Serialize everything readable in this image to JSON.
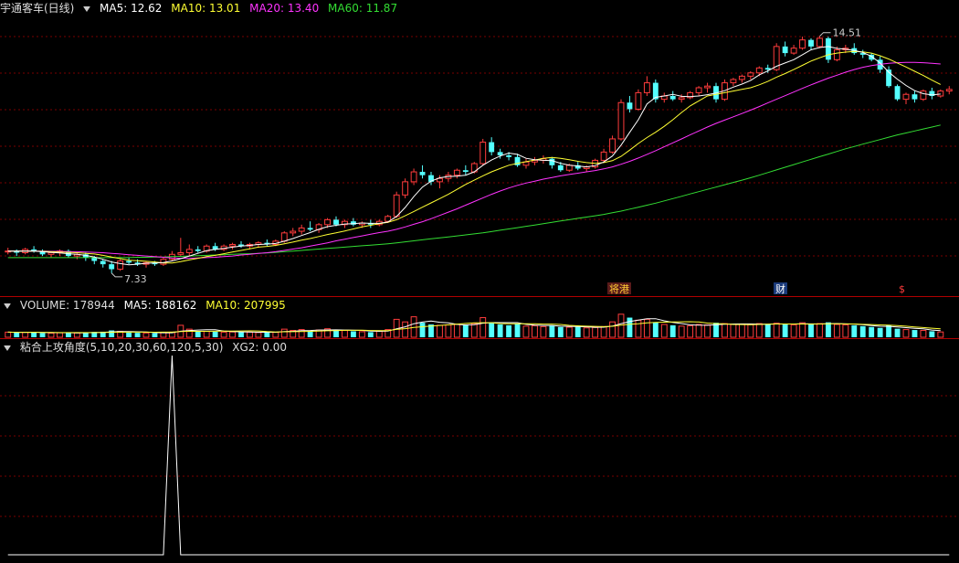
{
  "colors": {
    "up": "#ff3c3c",
    "down": "#54ffff",
    "ma5": "#ffffff",
    "ma10": "#ffff33",
    "ma20": "#ff33ff",
    "ma60": "#33dd33",
    "grid": "#7a0000",
    "signal": "#ffffff"
  },
  "price_header": {
    "stock": "宇通客车(日线)",
    "ma5": "MA5: 12.62",
    "ma10": "MA10: 13.01",
    "ma20": "MA20: 13.40",
    "ma60": "MA60: 11.87"
  },
  "volume_header": {
    "title": "VOLUME: 178944",
    "ma5": "MA5: 188162",
    "ma10": "MA10: 207995"
  },
  "indicator_header": {
    "title": "粘合上攻角度(5,10,20,30,60,120,5,30)",
    "xg2": "XG2: 0.00"
  },
  "markers": {
    "high": "14.51",
    "low": "7.33",
    "event1": "将港",
    "event2": "财",
    "event3": "$"
  },
  "chart_data": [
    {
      "type": "candlestick",
      "ylim": [
        6.8,
        15.0
      ],
      "ohlc": [
        [
          8.0,
          8.1,
          7.9,
          8.0
        ],
        [
          8.0,
          8.05,
          7.85,
          7.95
        ],
        [
          7.95,
          8.1,
          7.9,
          8.05
        ],
        [
          8.05,
          8.15,
          7.95,
          8.0
        ],
        [
          8.0,
          8.05,
          7.85,
          7.9
        ],
        [
          7.9,
          8.0,
          7.8,
          7.95
        ],
        [
          7.95,
          8.05,
          7.85,
          8.0
        ],
        [
          8.0,
          8.05,
          7.8,
          7.85
        ],
        [
          7.85,
          7.95,
          7.75,
          7.9
        ],
        [
          7.9,
          7.95,
          7.7,
          7.8
        ],
        [
          7.8,
          7.85,
          7.6,
          7.7
        ],
        [
          7.7,
          7.75,
          7.5,
          7.6
        ],
        [
          7.6,
          7.7,
          7.33,
          7.45
        ],
        [
          7.45,
          7.75,
          7.4,
          7.7
        ],
        [
          7.7,
          7.8,
          7.6,
          7.65
        ],
        [
          7.65,
          7.75,
          7.55,
          7.6
        ],
        [
          7.6,
          7.7,
          7.5,
          7.65
        ],
        [
          7.65,
          7.7,
          7.55,
          7.6
        ],
        [
          7.6,
          7.8,
          7.55,
          7.75
        ],
        [
          7.75,
          8.0,
          7.7,
          7.9
        ],
        [
          7.9,
          8.4,
          7.85,
          7.95
        ],
        [
          7.95,
          8.2,
          7.85,
          8.05
        ],
        [
          8.05,
          8.15,
          7.95,
          8.0
        ],
        [
          8.0,
          8.2,
          7.95,
          8.15
        ],
        [
          8.15,
          8.25,
          8.0,
          8.05
        ],
        [
          8.05,
          8.2,
          8.0,
          8.15
        ],
        [
          8.15,
          8.25,
          8.05,
          8.2
        ],
        [
          8.2,
          8.3,
          8.1,
          8.15
        ],
        [
          8.15,
          8.25,
          8.05,
          8.2
        ],
        [
          8.2,
          8.3,
          8.1,
          8.25
        ],
        [
          8.25,
          8.35,
          8.15,
          8.2
        ],
        [
          8.2,
          8.35,
          8.15,
          8.3
        ],
        [
          8.3,
          8.6,
          8.25,
          8.55
        ],
        [
          8.55,
          8.7,
          8.45,
          8.6
        ],
        [
          8.6,
          8.8,
          8.5,
          8.7
        ],
        [
          8.7,
          8.9,
          8.6,
          8.65
        ],
        [
          8.65,
          8.85,
          8.55,
          8.8
        ],
        [
          8.8,
          9.0,
          8.7,
          8.95
        ],
        [
          8.95,
          9.05,
          8.75,
          8.8
        ],
        [
          8.8,
          8.95,
          8.7,
          8.9
        ],
        [
          8.9,
          9.0,
          8.75,
          8.8
        ],
        [
          8.8,
          8.9,
          8.7,
          8.85
        ],
        [
          8.85,
          8.95,
          8.7,
          8.8
        ],
        [
          8.8,
          8.95,
          8.75,
          8.9
        ],
        [
          8.9,
          9.1,
          8.85,
          9.05
        ],
        [
          9.05,
          9.8,
          9.0,
          9.7
        ],
        [
          9.7,
          10.2,
          9.6,
          10.1
        ],
        [
          10.1,
          10.5,
          10.0,
          10.4
        ],
        [
          10.4,
          10.6,
          10.2,
          10.3
        ],
        [
          10.3,
          10.4,
          10.0,
          10.1
        ],
        [
          10.1,
          10.3,
          9.9,
          10.2
        ],
        [
          10.2,
          10.4,
          10.1,
          10.3
        ],
        [
          10.3,
          10.5,
          10.2,
          10.45
        ],
        [
          10.45,
          10.6,
          10.3,
          10.4
        ],
        [
          10.4,
          10.7,
          10.35,
          10.65
        ],
        [
          10.65,
          11.4,
          10.6,
          11.3
        ],
        [
          11.3,
          11.45,
          10.9,
          11.0
        ],
        [
          11.0,
          11.1,
          10.8,
          10.9
        ],
        [
          10.9,
          11.0,
          10.75,
          10.85
        ],
        [
          10.85,
          10.95,
          10.55,
          10.6
        ],
        [
          10.6,
          10.8,
          10.5,
          10.7
        ],
        [
          10.7,
          10.85,
          10.6,
          10.75
        ],
        [
          10.75,
          10.9,
          10.65,
          10.8
        ],
        [
          10.8,
          10.85,
          10.5,
          10.6
        ],
        [
          10.6,
          10.7,
          10.4,
          10.45
        ],
        [
          10.45,
          10.65,
          10.4,
          10.6
        ],
        [
          10.6,
          10.7,
          10.45,
          10.5
        ],
        [
          10.5,
          10.6,
          10.4,
          10.55
        ],
        [
          10.55,
          10.8,
          10.5,
          10.75
        ],
        [
          10.75,
          11.1,
          10.7,
          11.0
        ],
        [
          11.0,
          11.5,
          10.95,
          11.4
        ],
        [
          11.4,
          12.6,
          11.35,
          12.5
        ],
        [
          12.5,
          12.7,
          12.2,
          12.3
        ],
        [
          12.3,
          12.9,
          12.25,
          12.8
        ],
        [
          12.8,
          13.3,
          12.7,
          13.1
        ],
        [
          13.1,
          13.2,
          12.5,
          12.6
        ],
        [
          12.6,
          12.8,
          12.5,
          12.7
        ],
        [
          12.7,
          12.85,
          12.55,
          12.6
        ],
        [
          12.6,
          12.75,
          12.5,
          12.65
        ],
        [
          12.65,
          12.85,
          12.6,
          12.8
        ],
        [
          12.8,
          13.0,
          12.7,
          12.95
        ],
        [
          12.95,
          13.1,
          12.8,
          13.0
        ],
        [
          13.0,
          13.1,
          12.5,
          12.6
        ],
        [
          12.6,
          13.2,
          12.55,
          13.1
        ],
        [
          13.1,
          13.25,
          13.0,
          13.2
        ],
        [
          13.2,
          13.35,
          13.1,
          13.3
        ],
        [
          13.3,
          13.45,
          13.2,
          13.4
        ],
        [
          13.4,
          13.6,
          13.3,
          13.55
        ],
        [
          13.55,
          13.65,
          13.4,
          13.5
        ],
        [
          13.5,
          14.3,
          13.45,
          14.2
        ],
        [
          14.2,
          14.35,
          13.9,
          14.0
        ],
        [
          14.0,
          14.25,
          13.95,
          14.15
        ],
        [
          14.15,
          14.5,
          14.1,
          14.4
        ],
        [
          14.4,
          14.45,
          14.1,
          14.2
        ],
        [
          14.2,
          14.51,
          14.15,
          14.45
        ],
        [
          14.45,
          14.5,
          13.7,
          13.8
        ],
        [
          13.8,
          14.2,
          13.75,
          14.1
        ],
        [
          14.1,
          14.25,
          14.0,
          14.15
        ],
        [
          14.15,
          14.3,
          13.95,
          14.0
        ],
        [
          14.0,
          14.1,
          13.85,
          13.95
        ],
        [
          13.95,
          14.0,
          13.75,
          13.8
        ],
        [
          13.8,
          13.9,
          13.4,
          13.5
        ],
        [
          13.5,
          13.6,
          12.95,
          13.0
        ],
        [
          13.0,
          13.05,
          12.55,
          12.6
        ],
        [
          12.6,
          12.8,
          12.45,
          12.75
        ],
        [
          12.75,
          12.85,
          12.5,
          12.6
        ],
        [
          12.6,
          12.9,
          12.55,
          12.85
        ],
        [
          12.85,
          12.95,
          12.6,
          12.7
        ],
        [
          12.7,
          12.9,
          12.65,
          12.85
        ],
        [
          12.85,
          13.0,
          12.75,
          12.9
        ]
      ],
      "ma5": [
        8.0,
        8.0,
        8.0,
        8.0,
        7.98,
        7.96,
        7.94,
        7.92,
        7.9,
        7.87,
        7.82,
        7.75,
        7.67,
        7.62,
        7.58,
        7.6,
        7.63,
        7.64,
        7.65,
        7.7,
        7.77,
        7.85,
        7.93,
        8.01,
        8.05,
        8.08,
        8.12,
        8.15,
        8.17,
        8.2,
        8.21,
        8.23,
        8.3,
        8.38,
        8.47,
        8.56,
        8.66,
        8.74,
        8.78,
        8.82,
        8.83,
        8.85,
        8.84,
        8.84,
        8.88,
        9.05,
        9.32,
        9.65,
        9.94,
        10.12,
        10.22,
        10.26,
        10.27,
        10.3,
        10.4,
        10.6,
        10.76,
        10.88,
        10.97,
        10.93,
        10.81,
        10.77,
        10.75,
        10.74,
        10.66,
        10.6,
        10.58,
        10.55,
        10.59,
        10.7,
        10.88,
        11.21,
        11.6,
        11.98,
        12.46,
        12.66,
        12.7,
        12.75,
        12.69,
        12.68,
        12.7,
        12.74,
        12.79,
        12.86,
        12.97,
        13.06,
        13.17,
        13.34,
        13.46,
        13.6,
        13.7,
        13.8,
        13.95,
        14.1,
        14.17,
        14.2,
        14.14,
        14.12,
        14.08,
        14.02,
        13.9,
        13.7,
        13.42,
        13.21,
        13.02,
        12.86,
        12.77,
        12.73,
        12.76
      ],
      "ma10": [
        8.0,
        8.0,
        8.0,
        8.0,
        7.99,
        7.98,
        7.97,
        7.96,
        7.95,
        7.93,
        7.91,
        7.87,
        7.82,
        7.77,
        7.72,
        7.71,
        7.69,
        7.67,
        7.64,
        7.64,
        7.68,
        7.73,
        7.78,
        7.83,
        7.87,
        7.92,
        7.97,
        8.02,
        8.07,
        8.12,
        8.14,
        8.17,
        8.22,
        8.27,
        8.33,
        8.38,
        8.44,
        8.5,
        8.55,
        8.61,
        8.67,
        8.73,
        8.78,
        8.83,
        8.87,
        8.95,
        9.07,
        9.2,
        9.33,
        9.46,
        9.59,
        9.72,
        9.87,
        10.02,
        10.15,
        10.28,
        10.4,
        10.5,
        10.6,
        10.66,
        10.71,
        10.76,
        10.81,
        10.84,
        10.81,
        10.77,
        10.72,
        10.68,
        10.66,
        10.68,
        10.74,
        10.87,
        11.06,
        11.26,
        11.44,
        11.6,
        11.78,
        11.98,
        12.2,
        12.4,
        12.55,
        12.7,
        12.75,
        12.8,
        12.85,
        12.9,
        12.95,
        13.04,
        13.14,
        13.27,
        13.38,
        13.5,
        13.63,
        13.76,
        13.86,
        13.95,
        14.0,
        14.03,
        14.05,
        14.04,
        14.0,
        13.92,
        13.82,
        13.7,
        13.58,
        13.45,
        13.32,
        13.18,
        13.05
      ],
      "ma20": [
        8.0,
        8.0,
        8.0,
        8.0,
        8.0,
        7.99,
        7.99,
        7.98,
        7.98,
        7.97,
        7.96,
        7.95,
        7.93,
        7.91,
        7.89,
        7.87,
        7.85,
        7.83,
        7.81,
        7.79,
        7.78,
        7.78,
        7.79,
        7.8,
        7.81,
        7.83,
        7.85,
        7.88,
        7.9,
        7.93,
        7.95,
        7.98,
        8.02,
        8.06,
        8.1,
        8.15,
        8.2,
        8.25,
        8.31,
        8.36,
        8.41,
        8.46,
        8.51,
        8.56,
        8.6,
        8.66,
        8.73,
        8.81,
        8.89,
        8.98,
        9.08,
        9.18,
        9.28,
        9.39,
        9.5,
        9.61,
        9.72,
        9.82,
        9.91,
        9.99,
        10.06,
        10.12,
        10.18,
        10.23,
        10.28,
        10.32,
        10.36,
        10.4,
        10.44,
        10.49,
        10.55,
        10.63,
        10.72,
        10.82,
        10.93,
        11.04,
        11.16,
        11.28,
        11.4,
        11.52,
        11.64,
        11.76,
        11.87,
        11.97,
        12.07,
        12.17,
        12.27,
        12.38,
        12.49,
        12.6,
        12.71,
        12.82,
        12.93,
        13.04,
        13.14,
        13.24,
        13.33,
        13.42,
        13.5,
        13.57,
        13.62,
        13.66,
        13.69,
        13.71,
        13.72,
        13.72,
        13.71,
        13.69,
        13.67
      ],
      "ma60": [
        7.8,
        7.8,
        7.8,
        7.8,
        7.8,
        7.8,
        7.8,
        7.8,
        7.8,
        7.8,
        7.8,
        7.8,
        7.8,
        7.8,
        7.8,
        7.81,
        7.81,
        7.82,
        7.82,
        7.83,
        7.84,
        7.85,
        7.86,
        7.87,
        7.88,
        7.89,
        7.9,
        7.91,
        7.92,
        7.93,
        7.94,
        7.96,
        7.98,
        8.0,
        8.02,
        8.04,
        8.06,
        8.08,
        8.1,
        8.12,
        8.14,
        8.16,
        8.18,
        8.2,
        8.22,
        8.25,
        8.28,
        8.31,
        8.34,
        8.37,
        8.4,
        8.43,
        8.46,
        8.49,
        8.52,
        8.55,
        8.59,
        8.63,
        8.67,
        8.71,
        8.75,
        8.79,
        8.83,
        8.87,
        8.91,
        8.95,
        8.99,
        9.03,
        9.07,
        9.11,
        9.16,
        9.21,
        9.27,
        9.33,
        9.39,
        9.45,
        9.52,
        9.59,
        9.66,
        9.73,
        9.8,
        9.87,
        9.94,
        10.01,
        10.08,
        10.15,
        10.22,
        10.3,
        10.38,
        10.46,
        10.54,
        10.62,
        10.7,
        10.78,
        10.86,
        10.94,
        11.02,
        11.1,
        11.17,
        11.24,
        11.31,
        11.38,
        11.45,
        11.52,
        11.58,
        11.64,
        11.7,
        11.76,
        11.82
      ]
    },
    {
      "type": "bar",
      "name": "VOLUME",
      "volume": [
        60,
        55,
        58,
        62,
        50,
        48,
        52,
        55,
        50,
        58,
        62,
        65,
        80,
        70,
        55,
        52,
        50,
        48,
        55,
        60,
        140,
        95,
        75,
        70,
        65,
        60,
        62,
        58,
        60,
        55,
        62,
        58,
        95,
        80,
        90,
        75,
        85,
        100,
        85,
        80,
        70,
        65,
        60,
        72,
        90,
        210,
        180,
        240,
        170,
        150,
        140,
        145,
        150,
        140,
        160,
        230,
        175,
        150,
        140,
        160,
        130,
        135,
        125,
        140,
        120,
        118,
        122,
        110,
        115,
        125,
        180,
        270,
        230,
        200,
        210,
        175,
        150,
        140,
        130,
        135,
        150,
        145,
        170,
        160,
        150,
        155,
        148,
        160,
        155,
        165,
        150,
        145,
        170,
        150,
        160,
        175,
        150,
        145,
        140,
        130,
        120,
        110,
        140,
        100,
        90,
        85,
        80,
        70,
        62
      ],
      "ylim": [
        0,
        300
      ]
    },
    {
      "type": "line",
      "ylim": [
        0,
        1
      ],
      "spike_index": 19,
      "spike_value": 1
    }
  ]
}
